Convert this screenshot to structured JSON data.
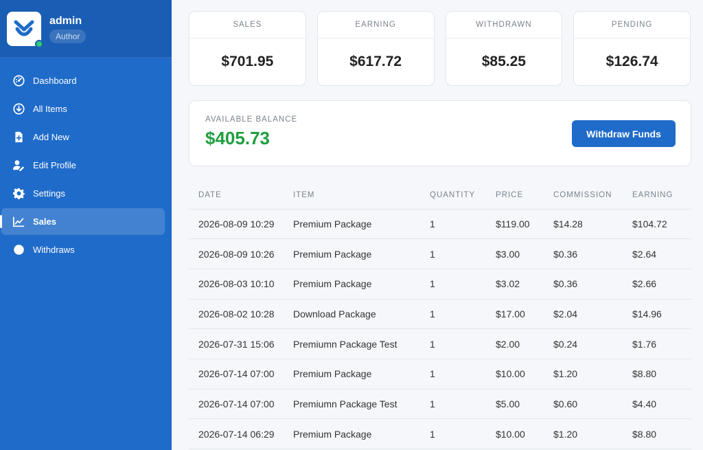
{
  "profile": {
    "name": "admin",
    "role": "Author"
  },
  "nav": [
    {
      "label": "Dashboard",
      "icon": "dashboard-icon"
    },
    {
      "label": "All Items",
      "icon": "download-circle-icon"
    },
    {
      "label": "Add New",
      "icon": "file-add-icon"
    },
    {
      "label": "Edit Profile",
      "icon": "user-edit-icon"
    },
    {
      "label": "Settings",
      "icon": "gear-icon"
    },
    {
      "label": "Sales",
      "icon": "chart-line-icon",
      "active": true
    },
    {
      "label": "Withdraws",
      "icon": "circle-icon"
    }
  ],
  "stats": [
    {
      "label": "SALES",
      "value": "$701.95"
    },
    {
      "label": "EARNING",
      "value": "$617.72"
    },
    {
      "label": "WITHDRAWN",
      "value": "$85.25"
    },
    {
      "label": "PENDING",
      "value": "$126.74"
    }
  ],
  "balance": {
    "label": "AVAILABLE BALANCE",
    "value": "$405.73",
    "button": "Withdraw Funds"
  },
  "table": {
    "headers": [
      "DATE",
      "ITEM",
      "QUANTITY",
      "PRICE",
      "COMMISSION",
      "EARNING"
    ],
    "rows": [
      [
        "2026-08-09 10:29",
        "Premium Package",
        "1",
        "$119.00",
        "$14.28",
        "$104.72"
      ],
      [
        "2026-08-09 10:26",
        "Premium Package",
        "1",
        "$3.00",
        "$0.36",
        "$2.64"
      ],
      [
        "2026-08-03 10:10",
        "Premium Package",
        "1",
        "$3.02",
        "$0.36",
        "$2.66"
      ],
      [
        "2026-08-02 10:28",
        "Download Package",
        "1",
        "$17.00",
        "$2.04",
        "$14.96"
      ],
      [
        "2026-07-31 15:06",
        "Premiumn Package Test",
        "1",
        "$2.00",
        "$0.24",
        "$1.76"
      ],
      [
        "2026-07-14 07:00",
        "Premium Package",
        "1",
        "$10.00",
        "$1.20",
        "$8.80"
      ],
      [
        "2026-07-14 07:00",
        "Premiumn Package Test",
        "1",
        "$5.00",
        "$0.60",
        "$4.40"
      ],
      [
        "2026-07-14 06:29",
        "Premium Package",
        "1",
        "$10.00",
        "$1.20",
        "$8.80"
      ]
    ]
  },
  "colors": {
    "sidebar": "#1f6bc9",
    "accent": "#1f6bc9",
    "positive": "#1e9e3e"
  }
}
